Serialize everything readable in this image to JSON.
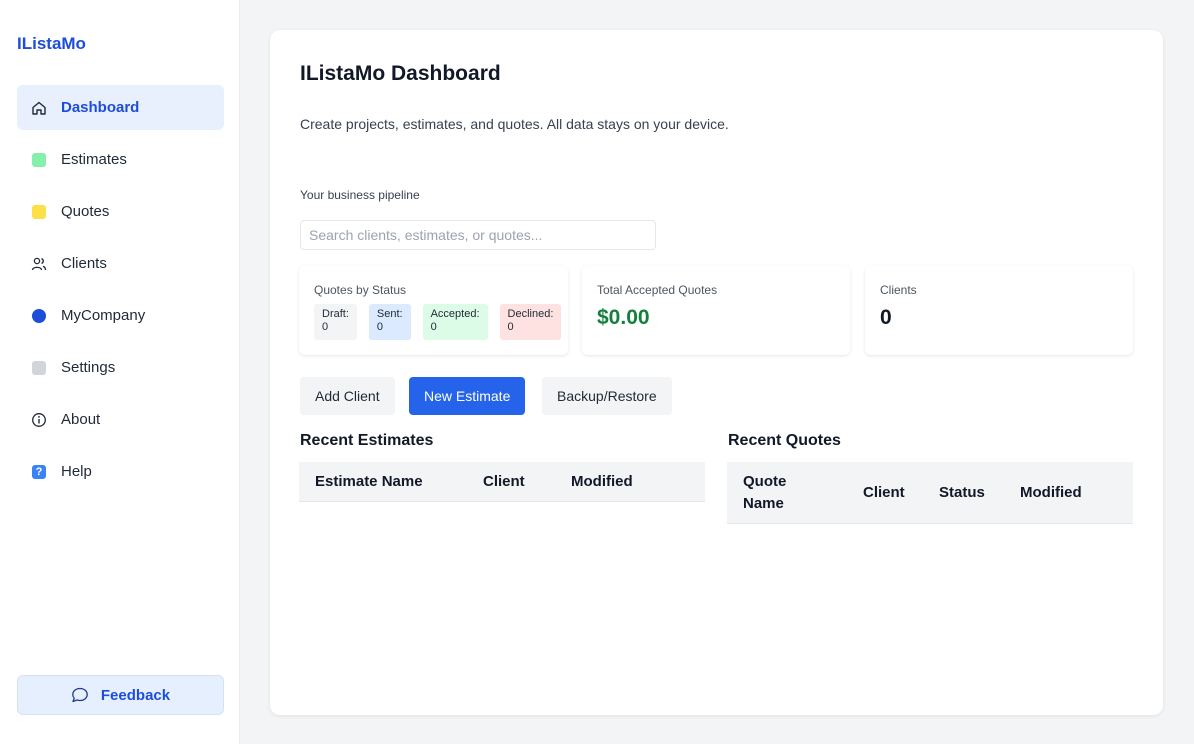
{
  "sidebar": {
    "brand": "IListaMo",
    "items": [
      {
        "label": "Dashboard",
        "icon": "home-icon",
        "active": true
      },
      {
        "label": "Estimates",
        "icon": "green-square-icon",
        "color": "#86efac"
      },
      {
        "label": "Quotes",
        "icon": "yellow-square-icon",
        "color": "#fde047"
      },
      {
        "label": "Clients",
        "icon": "users-icon"
      },
      {
        "label": "MyCompany",
        "icon": "blue-circle-icon",
        "color": "#1d4ed8"
      },
      {
        "label": "Settings",
        "icon": "gray-square-icon",
        "color": "#d1d5db"
      },
      {
        "label": "About",
        "icon": "info-icon"
      },
      {
        "label": "Help",
        "icon": "question-icon"
      }
    ],
    "feedback": {
      "label": "Feedback",
      "icon": "chat-bubble-icon"
    }
  },
  "main": {
    "title": "IListaMo Dashboard",
    "subtitle": "Create projects, estimates, and quotes. All data stays on your device.",
    "pipeline_label": "Your business pipeline",
    "search": {
      "placeholder": "Search clients, estimates, or quotes...",
      "value": ""
    },
    "stats": {
      "quotes_by_status": {
        "label": "Quotes by Status",
        "chips": [
          {
            "label": "Draft:",
            "value": "0",
            "color": "#f3f4f6"
          },
          {
            "label": "Sent:",
            "value": "0",
            "color": "#dbeafe"
          },
          {
            "label": "Accepted:",
            "value": "0",
            "color": "#dcfce7"
          },
          {
            "label": "Declined:",
            "value": "0",
            "color": "#fee2e2"
          }
        ]
      },
      "total_accepted": {
        "label": "Total Accepted Quotes",
        "value": "$0.00",
        "color": "#15803d"
      },
      "clients": {
        "label": "Clients",
        "value": "0"
      }
    },
    "buttons": {
      "add_client": "Add Client",
      "new_estimate": "New Estimate",
      "backup_restore": "Backup/Restore"
    },
    "recent_estimates": {
      "title": "Recent Estimates",
      "columns": [
        "Estimate Name",
        "Client",
        "Modified"
      ]
    },
    "recent_quotes": {
      "title": "Recent Quotes",
      "columns": [
        "Quote Name",
        "Client",
        "Status",
        "Modified"
      ]
    }
  }
}
